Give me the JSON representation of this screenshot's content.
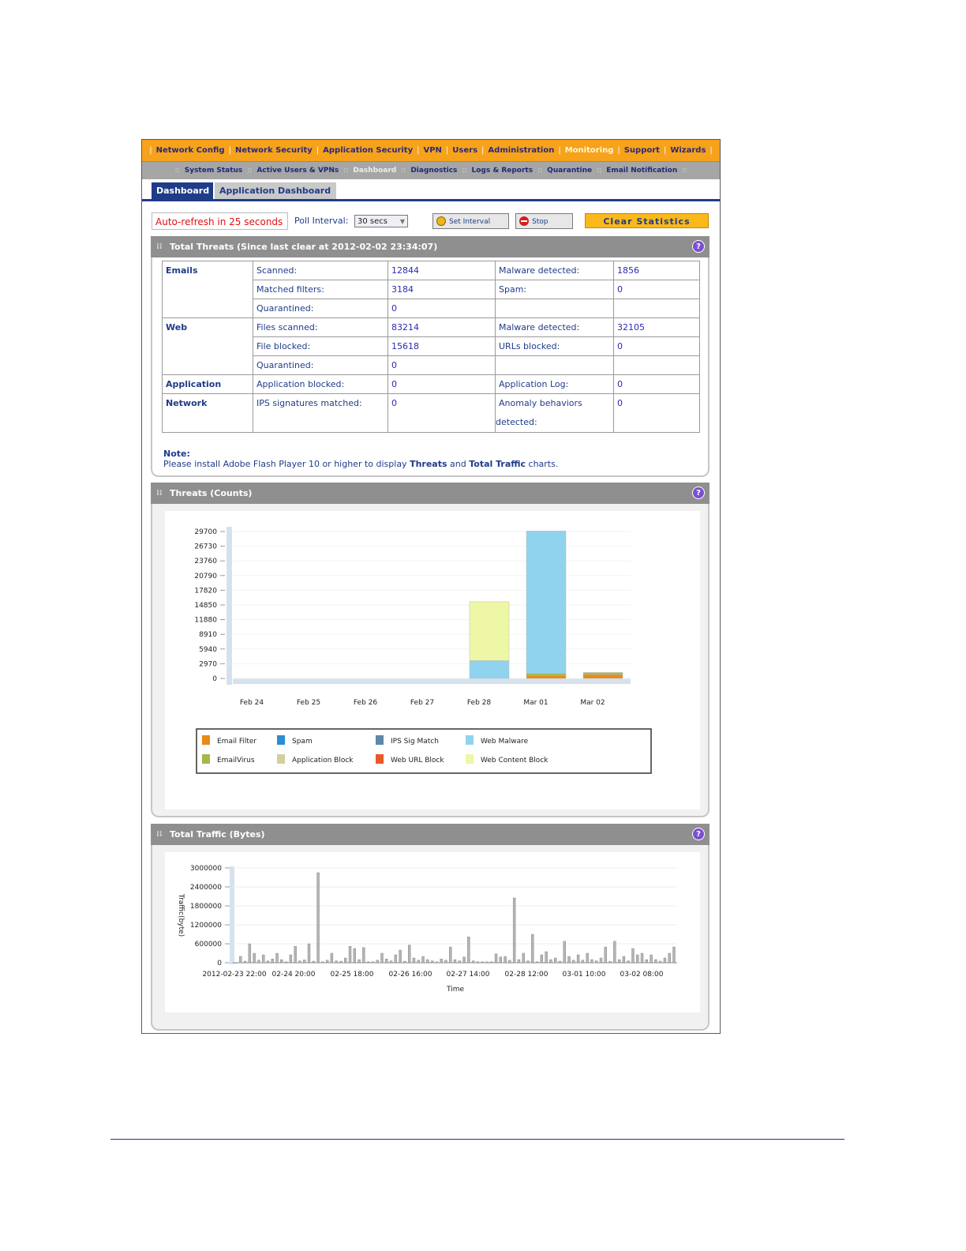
{
  "main_nav": {
    "items": [
      "Network Config",
      "Network Security",
      "Application Security",
      "VPN",
      "Users",
      "Administration",
      "Monitoring",
      "Support",
      "Wizards"
    ],
    "active": "Monitoring"
  },
  "sub_nav": {
    "items": [
      "System Status",
      "Active Users & VPNs",
      "Dashboard",
      "Diagnostics",
      "Logs & Reports",
      "Quarantine",
      "Email Notification"
    ],
    "active": "Dashboard"
  },
  "tabs": [
    {
      "label": "Dashboard",
      "selected": true
    },
    {
      "label": "Application Dashboard",
      "selected": false
    }
  ],
  "toolbar": {
    "auto_refresh": "Auto-refresh in 25 seconds",
    "poll_label": "Poll Interval:",
    "poll_value": "30 secs",
    "set_interval": "Set Interval",
    "stop": "Stop",
    "clear_stats": "Clear Statistics"
  },
  "threats_panel": {
    "title": "Total Threats (Since last clear at 2012-02-02 23:34:07)",
    "rows": [
      {
        "category": "Emails",
        "label1": "Scanned:",
        "value1": "12844",
        "label2": "Malware detected:",
        "value2": "1856"
      },
      {
        "category": "",
        "label1": "Matched filters:",
        "value1": "3184",
        "label2": "Spam:",
        "value2": "0"
      },
      {
        "category": "",
        "label1": "Quarantined:",
        "value1": "0",
        "label2": "",
        "value2": ""
      },
      {
        "category": "Web",
        "label1": "Files scanned:",
        "value1": "83214",
        "label2": "Malware detected:",
        "value2": "32105"
      },
      {
        "category": "",
        "label1": "File blocked:",
        "value1": "15618",
        "label2": "URLs blocked:",
        "value2": "0"
      },
      {
        "category": "",
        "label1": "Quarantined:",
        "value1": "0",
        "label2": "",
        "value2": ""
      },
      {
        "category": "Application",
        "label1": "Application blocked:",
        "value1": "0",
        "label2": "Application Log:",
        "value2": "0"
      },
      {
        "category": "Network",
        "label1": "IPS signatures matched:",
        "value1": "0",
        "label2": "Anomaly behaviors",
        "label2b": "detected:",
        "value2": "0"
      }
    ],
    "note_title": "Note:",
    "note_pre": "Please install Adobe Flash Player 10 or higher to display ",
    "note_b1": "Threats",
    "note_mid": " and ",
    "note_b2": "Total Traffic",
    "note_post": " charts."
  },
  "threats_chart_panel": {
    "title": "Threats (Counts)"
  },
  "traffic_chart_panel": {
    "title": "Total Traffic (Bytes)"
  },
  "colors": {
    "nav_orange": "#f7a21b",
    "navy": "#1f3c88",
    "panel_grey": "#8f8f8f",
    "email_filter": "#e8891a",
    "spam": "#2a8fd0",
    "ips_sig_match": "#5d88a8",
    "web_malware": "#8fd3ee",
    "email_virus": "#a7b84a",
    "application_block": "#d3cfa0",
    "web_url_block": "#e8582a",
    "web_content_block": "#eef7a6"
  },
  "chart_data": [
    {
      "type": "bar",
      "stacked": true,
      "categories": [
        "Feb 24",
        "Feb 25",
        "Feb 26",
        "Feb 27",
        "Feb 28",
        "Mar 01",
        "Mar 02"
      ],
      "yticks": [
        0,
        2970,
        5940,
        8910,
        11880,
        14850,
        17820,
        20790,
        23760,
        26730,
        29700
      ],
      "ylim": [
        0,
        29700
      ],
      "legend_position": "bottom",
      "legend": [
        "Email Filter",
        "Spam",
        "IPS Sig Match",
        "Web Malware",
        "EmailVirus",
        "Application Block",
        "Web URL Block",
        "Web Content Block"
      ],
      "series": [
        {
          "name": "Email Filter",
          "color": "#e8891a",
          "values": [
            0,
            0,
            0,
            0,
            0,
            600,
            800
          ]
        },
        {
          "name": "EmailVirus",
          "color": "#a7b84a",
          "values": [
            0,
            0,
            0,
            0,
            0,
            400,
            400
          ]
        },
        {
          "name": "Web Malware",
          "color": "#8fd3ee",
          "values": [
            0,
            0,
            0,
            0,
            3600,
            28800,
            0
          ]
        },
        {
          "name": "Web Content Block",
          "color": "#eef7a6",
          "values": [
            0,
            0,
            0,
            0,
            11900,
            0,
            0
          ]
        }
      ]
    },
    {
      "type": "bar",
      "ylabel": "Traffic(byte)",
      "xlabel": "Time",
      "yticks": [
        0,
        600000,
        1200000,
        1800000,
        2400000,
        3000000
      ],
      "ylim": [
        0,
        3000000
      ],
      "xtick_labels": [
        "2012-02-23 22:00",
        "02-24 20:00",
        "02-25 18:00",
        "02-26 16:00",
        "02-27 14:00",
        "02-28 12:00",
        "03-01 10:00",
        "03-02 08:00"
      ],
      "values": [
        0,
        200000,
        50000,
        600000,
        300000,
        80000,
        250000,
        60000,
        120000,
        300000,
        100000,
        30000,
        250000,
        520000,
        60000,
        90000,
        600000,
        50000,
        2850000,
        30000,
        80000,
        300000,
        60000,
        50000,
        150000,
        520000,
        450000,
        100000,
        480000,
        30000,
        30000,
        80000,
        300000,
        120000,
        60000,
        250000,
        400000,
        50000,
        560000,
        150000,
        80000,
        200000,
        100000,
        60000,
        30000,
        120000,
        80000,
        500000,
        100000,
        60000,
        180000,
        820000,
        60000,
        30000,
        30000,
        30000,
        30000,
        280000,
        180000,
        200000,
        80000,
        2050000,
        100000,
        300000,
        60000,
        900000,
        30000,
        250000,
        350000,
        100000,
        150000,
        50000,
        680000,
        200000,
        80000,
        250000,
        80000,
        300000,
        100000,
        60000,
        150000,
        500000,
        40000,
        680000,
        100000,
        200000,
        60000,
        450000,
        250000,
        300000,
        100000,
        250000,
        100000,
        50000,
        150000,
        300000,
        500000
      ]
    }
  ]
}
